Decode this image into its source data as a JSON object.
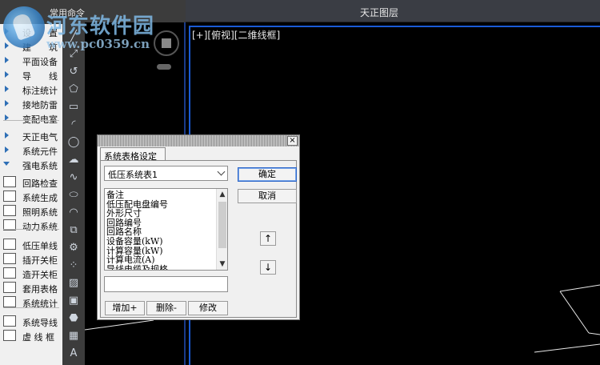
{
  "top_bar": {
    "left_title": "常用命令",
    "right_title": "天正图层"
  },
  "watermark": {
    "title": "河东软件园",
    "url": "www.pc0359.cn"
  },
  "viewport": {
    "label": "[+][俯视][二维线框]"
  },
  "left_menu": {
    "items": [
      {
        "label": "设　　置",
        "kind": "arrow"
      },
      {
        "label": "建　　筑",
        "kind": "arrow"
      },
      {
        "label": "平面设备",
        "kind": "arrow"
      },
      {
        "label": "导　　线",
        "kind": "arrow"
      },
      {
        "label": "标注统计",
        "kind": "arrow"
      },
      {
        "label": "接地防雷",
        "kind": "arrow"
      },
      {
        "label": "变配电室",
        "kind": "arrow"
      },
      {
        "label": "天正电气",
        "kind": "arrow"
      },
      {
        "label": "系统元件",
        "kind": "arrow"
      },
      {
        "label": "强电系统",
        "kind": "arrow-down"
      },
      {
        "label": "回路检查",
        "kind": "tool"
      },
      {
        "label": "系统生成",
        "kind": "tool"
      },
      {
        "label": "照明系统",
        "kind": "tool"
      },
      {
        "label": "动力系统",
        "kind": "tool"
      },
      {
        "label": "低压单线",
        "kind": "tool"
      },
      {
        "label": "插开关柜",
        "kind": "tool"
      },
      {
        "label": "造开关柜",
        "kind": "tool"
      },
      {
        "label": "套用表格",
        "kind": "tool"
      },
      {
        "label": "系统统计",
        "kind": "tool"
      },
      {
        "label": "系统导线",
        "kind": "tool"
      },
      {
        "label": "虚 线 框",
        "kind": "tool"
      }
    ]
  },
  "toolbar": {
    "buttons": [
      {
        "name": "line-tool-icon",
        "glyph": "╱"
      },
      {
        "name": "polyline-tool-icon",
        "glyph": "⤢"
      },
      {
        "name": "arc-polyline-tool-icon",
        "glyph": "↺"
      },
      {
        "name": "polygon-tool-icon",
        "glyph": "⬠"
      },
      {
        "name": "rectangle-tool-icon",
        "glyph": "▭"
      },
      {
        "name": "arc-tool-icon",
        "glyph": "◜"
      },
      {
        "name": "circle-tool-icon",
        "glyph": "◯"
      },
      {
        "name": "revcloud-tool-icon",
        "glyph": "☁"
      },
      {
        "name": "spline-tool-icon",
        "glyph": "∿"
      },
      {
        "name": "ellipse-tool-icon",
        "glyph": "⬭"
      },
      {
        "name": "ellipse-arc-tool-icon",
        "glyph": "◠"
      },
      {
        "name": "insert-block-tool-icon",
        "glyph": "⧉"
      },
      {
        "name": "make-block-tool-icon",
        "glyph": "⚙"
      },
      {
        "name": "point-tool-icon",
        "glyph": "⁘"
      },
      {
        "name": "hatch-tool-icon",
        "glyph": "▨"
      },
      {
        "name": "gradient-tool-icon",
        "glyph": "▣"
      },
      {
        "name": "region-tool-icon",
        "glyph": "⬣"
      },
      {
        "name": "table-tool-icon",
        "glyph": "▦"
      },
      {
        "name": "text-tool-icon",
        "glyph": "A"
      }
    ]
  },
  "dialog": {
    "tab_label": "系统表格设定",
    "close_glyph": "×",
    "selected_table": "低压系统表1",
    "fields": [
      "备注",
      "低压配电盘编号",
      "外形尺寸",
      "回路编号",
      "回路名称",
      "设备容量(kW)",
      "计算容量(kW)",
      "计算电流(A)",
      "导线电缆及规格"
    ],
    "ok_label": "确定",
    "cancel_label": "取消",
    "up_label": "↑",
    "down_label": "↓",
    "add_label": "增加+",
    "delete_label": "删除-",
    "edit_label": "修改",
    "scroll_up_glyph": "▲",
    "scroll_down_glyph": "▼"
  }
}
